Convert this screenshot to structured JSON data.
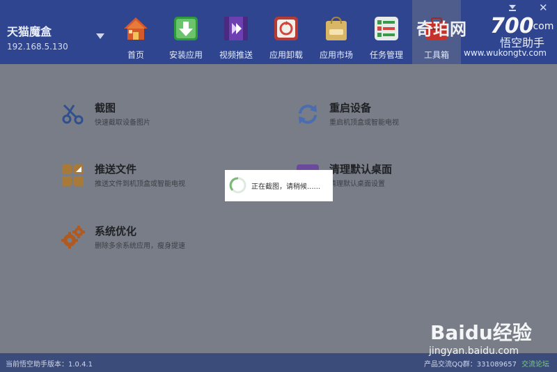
{
  "device": {
    "name": "天猫魔盒",
    "ip": "192.168.5.130"
  },
  "nav": [
    {
      "label": "首页",
      "icon": "home-icon",
      "color": "#d45a2e",
      "active": false
    },
    {
      "label": "安装应用",
      "icon": "install-icon",
      "color": "#2f9c3e",
      "active": false
    },
    {
      "label": "视频推送",
      "icon": "video-push-icon",
      "color": "#8a4cc2",
      "active": false
    },
    {
      "label": "应用卸载",
      "icon": "uninstall-icon",
      "color": "#c4453f",
      "active": false
    },
    {
      "label": "应用市场",
      "icon": "app-market-icon",
      "color": "#d9b768",
      "active": false
    },
    {
      "label": "任务管理",
      "icon": "task-manager-icon",
      "color": "#3e9b53",
      "active": false
    },
    {
      "label": "工具箱",
      "icon": "toolbox-icon",
      "color": "#c4322b",
      "active": true
    }
  ],
  "brand": {
    "cn": "奇珀网",
    "num": "700",
    "com": ".com",
    "wukong": "悟空助手",
    "url": "www.wukongtv.com"
  },
  "tools": [
    {
      "title": "截图",
      "desc": "快速截取设备图片",
      "icon": "scissors-icon"
    },
    {
      "title": "重启设备",
      "desc": "重启机顶盒或智能电视",
      "icon": "refresh-icon"
    },
    {
      "title": "推送文件",
      "desc": "推送文件到机顶盒或智能电视",
      "icon": "push-file-icon"
    },
    {
      "title": "清理默认桌面",
      "desc": "清理默认桌面设置",
      "icon": "clean-desktop-icon"
    },
    {
      "title": "系统优化",
      "desc": "删除多余系统应用，瘦身提速",
      "icon": "gears-icon"
    }
  ],
  "loading": {
    "text": "正在截图，请稍候......"
  },
  "footer": {
    "version": "当前悟空助手版本：1.0.4.1",
    "qq": "产品交流QQ群：331089657",
    "forum": "交流论坛"
  },
  "watermark": {
    "logo": "Baidu经验",
    "url": "jingyan.baidu.com"
  },
  "colors": {
    "header": "#2f458f",
    "content": "#787d87",
    "footer": "#3b4b7a"
  }
}
